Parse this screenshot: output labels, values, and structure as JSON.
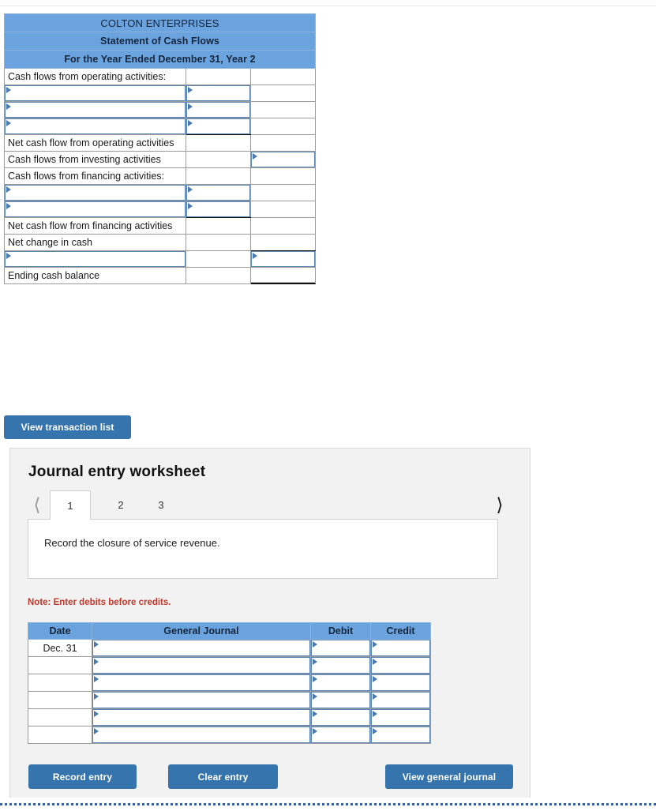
{
  "statement": {
    "company": "COLTON ENTERPRISES",
    "title": "Statement of Cash Flows",
    "period": "For the Year Ended December 31, Year 2",
    "rows": [
      {
        "label": "Cash flows from operating activities:",
        "label_input": false,
        "mid": "blank",
        "right": "blank"
      },
      {
        "label": "",
        "label_input": true,
        "mid": "input",
        "right": "blank"
      },
      {
        "label": "",
        "label_input": true,
        "mid": "input",
        "right": "blank"
      },
      {
        "label": "",
        "label_input": true,
        "mid": "input-underline",
        "right": "blank"
      },
      {
        "label": "Net cash flow from operating activities",
        "label_input": false,
        "mid": "blank",
        "right": "blank"
      },
      {
        "label": "Cash flows from investing activities",
        "label_input": false,
        "mid": "blank",
        "right": "input"
      },
      {
        "label": "Cash flows from financing activities:",
        "label_input": false,
        "mid": "blank",
        "right": "blank"
      },
      {
        "label": "",
        "label_input": true,
        "mid": "input",
        "right": "blank"
      },
      {
        "label": "",
        "label_input": true,
        "mid": "input-underline",
        "right": "blank"
      },
      {
        "label": "Net cash flow from financing activities",
        "label_input": false,
        "mid": "blank",
        "right": "blank"
      },
      {
        "label": "Net change in cash",
        "label_input": false,
        "mid": "blank",
        "right": "blank-underline"
      },
      {
        "label": "",
        "label_input": true,
        "mid": "blank",
        "right": "input"
      },
      {
        "label": "Ending cash balance",
        "label_input": false,
        "mid": "blank",
        "right": "blank-double"
      }
    ]
  },
  "toolbar": {
    "view_transaction_list": "View transaction list"
  },
  "journal": {
    "heading": "Journal entry worksheet",
    "prev_icon": "chevron-left",
    "next_icon": "chevron-right",
    "tabs": [
      {
        "label": "1",
        "active": true
      },
      {
        "label": "2",
        "active": false
      },
      {
        "label": "3",
        "active": false
      }
    ],
    "instruction": "Record the closure of service revenue.",
    "note": "Note: Enter debits before credits.",
    "columns": [
      "Date",
      "General Journal",
      "Debit",
      "Credit"
    ],
    "rows": [
      {
        "date": "Dec. 31",
        "date_input": false,
        "general_journal": "",
        "debit": "",
        "credit": ""
      },
      {
        "date": "",
        "date_input": false,
        "general_journal": "",
        "debit": "",
        "credit": ""
      },
      {
        "date": "",
        "date_input": false,
        "general_journal": "",
        "debit": "",
        "credit": ""
      },
      {
        "date": "",
        "date_input": false,
        "general_journal": "",
        "debit": "",
        "credit": ""
      },
      {
        "date": "",
        "date_input": false,
        "general_journal": "",
        "debit": "",
        "credit": ""
      },
      {
        "date": "",
        "date_input": false,
        "general_journal": "",
        "debit": "",
        "credit": ""
      }
    ],
    "buttons": {
      "record": "Record entry",
      "clear": "Clear entry",
      "view_general_journal": "View general journal"
    }
  },
  "colors": {
    "header_blue": "#6aa3dd",
    "button_blue": "#3574ad",
    "panel_gray": "#f2f2f2",
    "note_red": "#c0392b",
    "input_border": "#5b85b5"
  }
}
